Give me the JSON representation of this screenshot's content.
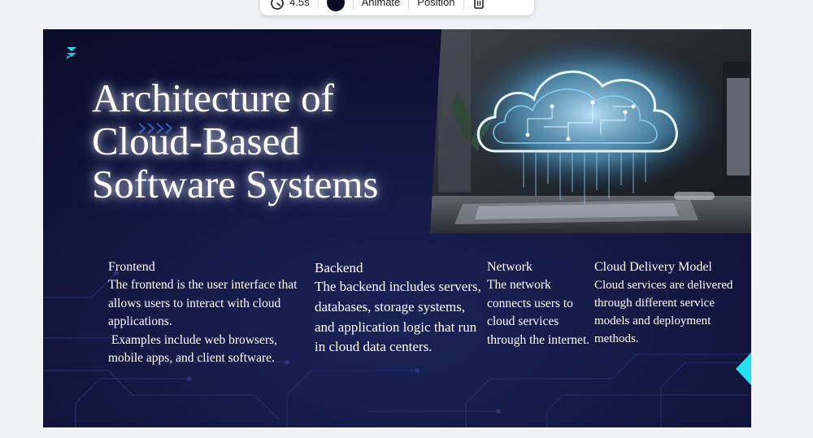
{
  "toolbar": {
    "duration_label": "4.5s",
    "color_value": "#0c0d24",
    "animate_label": "Animate",
    "position_label": "Position"
  },
  "slide": {
    "title_lines": [
      "Architecture of",
      "Cloud-Based",
      "Software Systems"
    ],
    "columns": [
      {
        "heading": "Frontend",
        "paragraphs": [
          "The frontend is the user interface that allows users to interact with cloud applications.",
          " Examples include web browsers, mobile apps, and client software."
        ]
      },
      {
        "heading": "Backend",
        "paragraphs": [
          "The backend includes servers, databases, storage systems, and application logic that run in cloud data centers."
        ]
      },
      {
        "heading": "Network",
        "paragraphs": [
          "The network connects users to cloud services through the internet."
        ]
      },
      {
        "heading": "Cloud Delivery Model",
        "paragraphs": [
          "Cloud services are delivered through different service models and deployment methods."
        ]
      }
    ]
  },
  "colors": {
    "slide_bg": "#10133a",
    "accent_cyan": "#22e0f0",
    "text": "#ffffff"
  },
  "icons": {
    "timer": "stopwatch-icon",
    "delete": "trash-icon",
    "logo": "brand-logo-icon"
  }
}
